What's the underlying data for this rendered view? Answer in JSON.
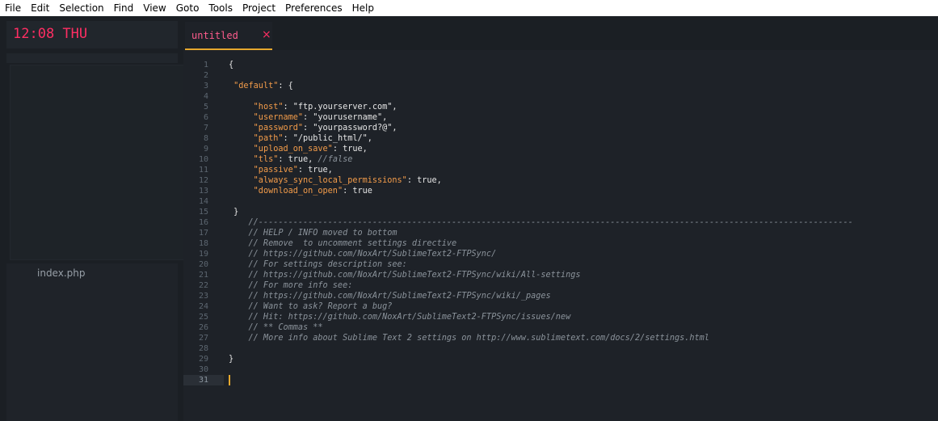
{
  "menu": [
    "File",
    "Edit",
    "Selection",
    "Find",
    "View",
    "Goto",
    "Tools",
    "Project",
    "Preferences",
    "Help"
  ],
  "sidebar": {
    "clock": "12:08 THU",
    "files": [
      "index.php"
    ]
  },
  "tab": {
    "title": "untitled",
    "close": "×"
  },
  "editor": {
    "active_line": 31,
    "lines": [
      [
        {
          "t": "{",
          "c": "p"
        }
      ],
      [],
      [
        {
          "t": " ",
          "c": "p"
        },
        {
          "t": "\"default\"",
          "c": "k"
        },
        {
          "t": ": {",
          "c": "p"
        }
      ],
      [],
      [
        {
          "t": "     ",
          "c": "p"
        },
        {
          "t": "\"host\"",
          "c": "k"
        },
        {
          "t": ": \"ftp.yourserver.com\",",
          "c": "p"
        }
      ],
      [
        {
          "t": "     ",
          "c": "p"
        },
        {
          "t": "\"username\"",
          "c": "k"
        },
        {
          "t": ": \"yourusername\",",
          "c": "p"
        }
      ],
      [
        {
          "t": "     ",
          "c": "p"
        },
        {
          "t": "\"password\"",
          "c": "k"
        },
        {
          "t": ": \"yourpassword?@\",",
          "c": "p"
        }
      ],
      [
        {
          "t": "     ",
          "c": "p"
        },
        {
          "t": "\"path\"",
          "c": "k"
        },
        {
          "t": ": \"/public_html/\",",
          "c": "p"
        }
      ],
      [
        {
          "t": "     ",
          "c": "p"
        },
        {
          "t": "\"upload_on_save\"",
          "c": "k"
        },
        {
          "t": ": true,",
          "c": "p"
        }
      ],
      [
        {
          "t": "     ",
          "c": "p"
        },
        {
          "t": "\"tls\"",
          "c": "k"
        },
        {
          "t": ": true, ",
          "c": "p"
        },
        {
          "t": "//false",
          "c": "cm"
        }
      ],
      [
        {
          "t": "     ",
          "c": "p"
        },
        {
          "t": "\"passive\"",
          "c": "k"
        },
        {
          "t": ": true,",
          "c": "p"
        }
      ],
      [
        {
          "t": "     ",
          "c": "p"
        },
        {
          "t": "\"always_sync_local_permissions\"",
          "c": "k"
        },
        {
          "t": ": true,",
          "c": "p"
        }
      ],
      [
        {
          "t": "     ",
          "c": "p"
        },
        {
          "t": "\"download_on_open\"",
          "c": "k"
        },
        {
          "t": ": true",
          "c": "p"
        }
      ],
      [],
      [
        {
          "t": " }",
          "c": "p"
        }
      ],
      [
        {
          "t": "    //------------------------------------------------------------------------------------------------------------------------",
          "c": "cm"
        }
      ],
      [
        {
          "t": "    // HELP / INFO moved to bottom",
          "c": "cm"
        }
      ],
      [
        {
          "t": "    // Remove  to uncomment settings directive",
          "c": "cm"
        }
      ],
      [
        {
          "t": "    // https://github.com/NoxArt/SublimeText2-FTPSync/",
          "c": "cm"
        }
      ],
      [
        {
          "t": "    // For settings description see:",
          "c": "cm"
        }
      ],
      [
        {
          "t": "    // https://github.com/NoxArt/SublimeText2-FTPSync/wiki/All-settings",
          "c": "cm"
        }
      ],
      [
        {
          "t": "    // For more info see:",
          "c": "cm"
        }
      ],
      [
        {
          "t": "    // https://github.com/NoxArt/SublimeText2-FTPSync/wiki/_pages",
          "c": "cm"
        }
      ],
      [
        {
          "t": "    // Want to ask? Report a bug?",
          "c": "cm"
        }
      ],
      [
        {
          "t": "    // Hit: https://github.com/NoxArt/SublimeText2-FTPSync/issues/new",
          "c": "cm"
        }
      ],
      [
        {
          "t": "    // ** Commas **",
          "c": "cm"
        }
      ],
      [
        {
          "t": "    // More info about Sublime Text 2 settings on http://www.sublimetext.com/docs/2/settings.html",
          "c": "cm"
        }
      ],
      [],
      [
        {
          "t": "}",
          "c": "p"
        }
      ],
      [],
      []
    ]
  },
  "colors": {
    "accent": "#ff2e63",
    "key": "#f39c4a",
    "comment": "#8b939b",
    "cursor": "#e6a82e",
    "background": "#1e2228"
  }
}
